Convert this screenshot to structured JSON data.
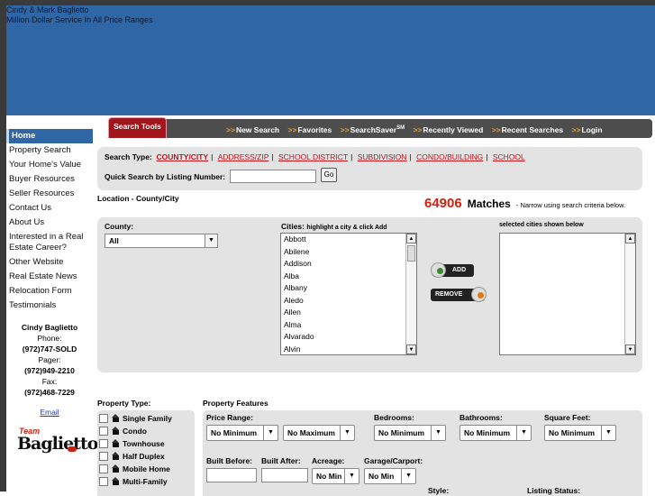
{
  "header": {
    "line1": "Cindy & Mark Baglietto",
    "line2": "Million Dollar Service In All Price Ranges"
  },
  "sidebar": {
    "items": [
      {
        "label": "Home"
      },
      {
        "label": "Property Search"
      },
      {
        "label": "Your Home's Value"
      },
      {
        "label": "Buyer Resources"
      },
      {
        "label": "Seller Resources"
      },
      {
        "label": "Contact Us"
      },
      {
        "label": "About Us"
      },
      {
        "label": "Interested in a Real Estate Career?"
      },
      {
        "label": "Other Website"
      },
      {
        "label": "Real Estate News"
      },
      {
        "label": "Relocation Form"
      },
      {
        "label": "Testimonials"
      }
    ],
    "contact": {
      "name": "Cindy Baglietto",
      "phone_label": "Phone:",
      "phone": "(972)747-SOLD",
      "pager_label": "Pager:",
      "pager": "(972)949-2210",
      "fax_label": "Fax:",
      "fax": "(972)468-7229",
      "email_link": "Email"
    },
    "logo": {
      "team": "Team",
      "name": "Baglietto"
    }
  },
  "toolbar": {
    "tab_label": "Search Tools",
    "links": [
      "New Search",
      "Favorites",
      "SearchSaver",
      "Recently Viewed",
      "Recent Searches",
      "Login"
    ],
    "searchsaver_sup": "SM"
  },
  "search_type": {
    "label": "Search Type:",
    "options": [
      "COUNTY/CITY",
      "ADDRESS/ZIP",
      "SCHOOL DISTRICT",
      "SUBDIVISION",
      "CONDO/BUILDING",
      "SCHOOL"
    ],
    "quick_label": "Quick Search by Listing Number:",
    "quick_value": "",
    "go_label": "Go"
  },
  "location": {
    "title": "Location - County/City",
    "match_count": "64906",
    "match_word": "Matches",
    "match_hint": "- Narrow using search criteria below.",
    "county_label": "County:",
    "county_value": "All",
    "cities_label": "Cities:",
    "cities_hint": "highlight a city & click Add",
    "cities": [
      "Abbott",
      "Abilene",
      "Addison",
      "Alba",
      "Albany",
      "Aledo",
      "Allen",
      "Alma",
      "Alvarado",
      "Alvin"
    ],
    "selected_label": "selected cities shown below",
    "add_label": "ADD",
    "remove_label": "REMOVE"
  },
  "property_type": {
    "label": "Property Type:",
    "items": [
      "Single Family",
      "Condo",
      "Townhouse",
      "Half Duplex",
      "Mobile Home",
      "Multi-Family"
    ]
  },
  "property_features": {
    "label": "Property Features",
    "price_range_label": "Price Range:",
    "price_min": "No Minimum",
    "price_max": "No Maximum",
    "bedrooms_label": "Bedrooms:",
    "bedrooms_value": "No Minimum",
    "bathrooms_label": "Bathrooms:",
    "bathrooms_value": "No Minimum",
    "sqft_label": "Square Feet:",
    "sqft_value": "No Minimum",
    "built_before_label": "Built Before:",
    "built_after_label": "Built After:",
    "acreage_label": "Acreage:",
    "acreage_value": "No Min",
    "garage_label": "Garage/Carport:",
    "garage_value": "No Min",
    "style_label": "Style:",
    "listing_status_label": "Listing Status:"
  },
  "colors": {
    "header_blue": "#2f66a6",
    "tab_red": "#a2151b",
    "match_red": "#d32011",
    "link_red": "#c0141b",
    "toolbar_arrow": "#f4a11a"
  }
}
